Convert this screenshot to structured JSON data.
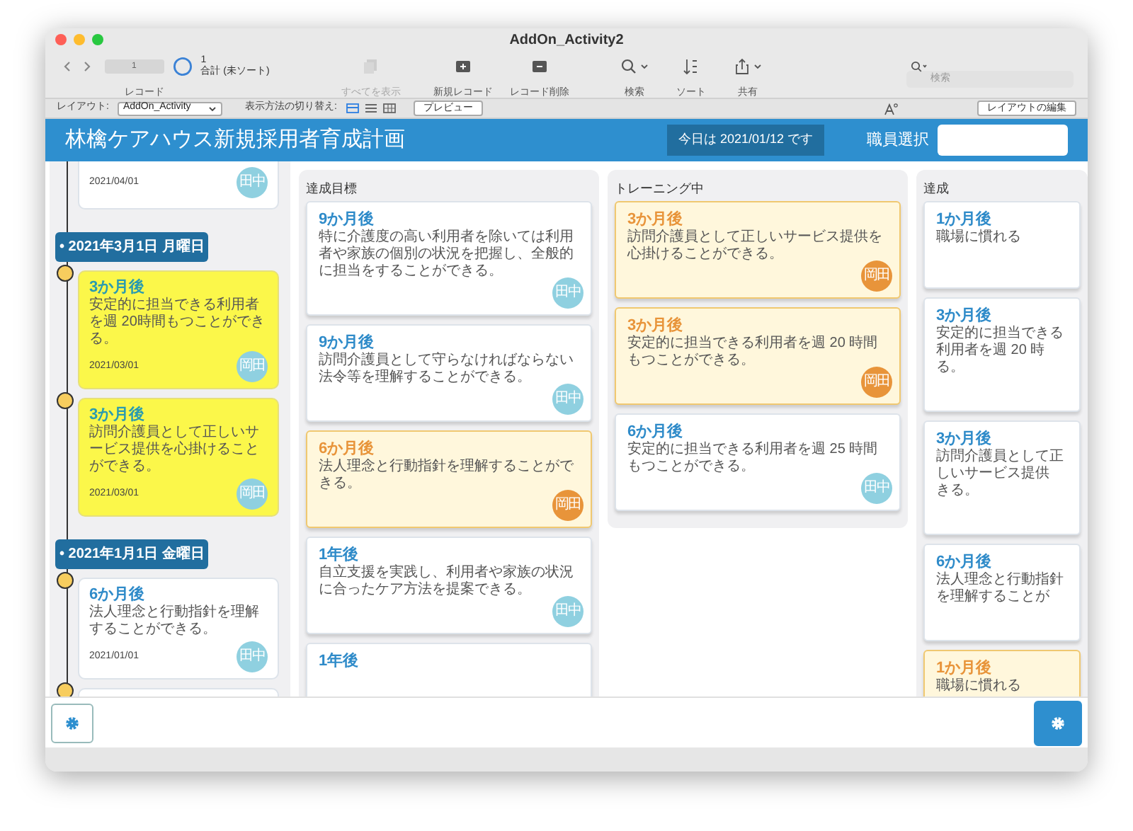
{
  "window": {
    "title": "AddOn_Activity2"
  },
  "toolbar": {
    "record_number": "1",
    "record_count": "1",
    "record_status": "合計 (未ソート)",
    "record_label": "レコード",
    "actions": [
      {
        "kind": "show-all",
        "label": "すべてを表示",
        "disabled": true
      },
      {
        "kind": "new",
        "label": "新規レコード",
        "disabled": false
      },
      {
        "kind": "delete",
        "label": "レコード削除",
        "disabled": false
      },
      {
        "kind": "search",
        "label": "検索",
        "disabled": false
      },
      {
        "kind": "sort",
        "label": "ソート",
        "disabled": false
      },
      {
        "kind": "share",
        "label": "共有",
        "disabled": false
      }
    ],
    "search": {
      "placeholder": "検索"
    }
  },
  "layout_bar": {
    "layout_label": "レイアウト:",
    "layout": "AddOn_Activity",
    "view_label": "表示方法の切り替え:",
    "views": [
      {
        "kind": "form",
        "selected": true
      },
      {
        "kind": "list",
        "selected": false
      },
      {
        "kind": "table",
        "selected": false
      }
    ],
    "preview": "プレビュー",
    "edit_layout": "レイアウトの編集"
  },
  "header": {
    "title": "林檎ケアハウス新規採用者育成計画",
    "today": "今日は 2021/01/12 です",
    "staff_label": "職員選択"
  },
  "timeline": [
    {
      "kind": "card",
      "highlighted": false,
      "date": "2021/04/01",
      "badge": {
        "text": "田中",
        "color": "#8fd0e0"
      }
    },
    {
      "kind": "date",
      "text": "• 2021年3月1日 月曜日"
    },
    {
      "kind": "card",
      "highlighted": true,
      "title": "3か月後",
      "lines": [
        "安定的に担当できる利用者を週 20",
        "時間もつことができる。"
      ],
      "date": "2021/03/01",
      "badge": {
        "text": "岡田",
        "color": "#8fd0e0"
      }
    },
    {
      "kind": "card",
      "highlighted": true,
      "title": "3か月後",
      "lines": [
        "訪問介護員として正しいサービス提",
        "供を心掛けることができる。"
      ],
      "date": "2021/03/01",
      "badge": {
        "text": "岡田",
        "color": "#8fd0e0"
      }
    },
    {
      "kind": "date",
      "text": "• 2021年1月1日 金曜日"
    },
    {
      "kind": "card",
      "highlighted": false,
      "title": "6か月後",
      "lines": [
        "法人理念と行動指針を理解すること",
        "ができる。"
      ],
      "date": "2021/01/01",
      "badge": {
        "text": "田中",
        "color": "#8fd0e0"
      }
    },
    {
      "kind": "card",
      "highlighted": false
    }
  ],
  "columns": [
    {
      "title": "達成目標",
      "cards": [
        {
          "highlighted": false,
          "title": "9か月後",
          "lines": [
            "特に介護度の高い利用者を除いては利用者や家族の個別の",
            "状況を把握し、全般的に担当をすることができる。"
          ],
          "badge": {
            "text": "田中",
            "color": "#8fd0e0"
          }
        },
        {
          "highlighted": false,
          "title": "9か月後",
          "lines": [
            "訪問介護員として守らなければならない法令等を理解する",
            "ことができる。"
          ],
          "badge": {
            "text": "田中",
            "color": "#8fd0e0"
          }
        },
        {
          "highlighted": true,
          "title": "6か月後",
          "lines": [
            "法人理念と行動指針を理解することができる。"
          ],
          "badge": {
            "text": "岡田",
            "color": "#e8943a"
          }
        },
        {
          "highlighted": false,
          "title": "1年後",
          "lines": [
            "自立支援を実践し、利用者や家族の状況に合ったケア方法",
            "を提案できる。"
          ],
          "badge": {
            "text": "田中",
            "color": "#8fd0e0"
          }
        },
        {
          "highlighted": false,
          "title": "1年後"
        }
      ]
    },
    {
      "title": "トレーニング中",
      "cards": [
        {
          "highlighted": true,
          "title": "3か月後",
          "lines": [
            "訪問介護員として正しいサービス提供を心掛けることがで",
            "きる。"
          ],
          "badge": {
            "text": "岡田",
            "color": "#e8943a"
          }
        },
        {
          "highlighted": true,
          "title": "3か月後",
          "lines": [
            "安定的に担当できる利用者を週 20 時間もつことができ",
            "る。"
          ],
          "badge": {
            "text": "岡田",
            "color": "#e8943a"
          }
        },
        {
          "highlighted": false,
          "title": "6か月後",
          "lines": [
            "安定的に担当できる利用者を週 25 時間もつことができ",
            "る。"
          ],
          "badge": {
            "text": "田中",
            "color": "#8fd0e0"
          }
        }
      ]
    },
    {
      "title": "達成",
      "cards": [
        {
          "highlighted": false,
          "title": "1か月後",
          "lines": [
            "職場に慣れる"
          ]
        },
        {
          "highlighted": false,
          "title": "3か月後",
          "lines": [
            "安定的に担当できる利用者を週 20 時",
            "る。"
          ]
        },
        {
          "highlighted": false,
          "title": "3か月後",
          "lines": [
            "訪問介護員として正しいサービス提供",
            "きる。"
          ]
        },
        {
          "highlighted": false,
          "title": "6か月後",
          "lines": [
            "法人理念と行動指針を理解することが"
          ]
        },
        {
          "highlighted": true,
          "title": "1か月後",
          "lines": [
            "職場に慣れる"
          ]
        }
      ]
    }
  ]
}
